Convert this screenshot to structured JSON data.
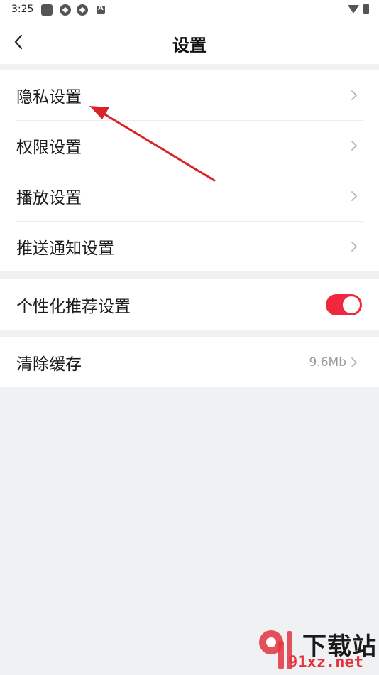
{
  "status_bar": {
    "time": "3:25"
  },
  "header": {
    "title": "设置",
    "back_icon": "chevron-left-icon"
  },
  "section_1": {
    "items": [
      {
        "label": "隐私设置"
      },
      {
        "label": "权限设置"
      },
      {
        "label": "播放设置"
      },
      {
        "label": "推送通知设置"
      }
    ]
  },
  "section_2": {
    "label": "个性化推荐设置",
    "toggle_on": true
  },
  "section_3": {
    "label": "清除缓存",
    "value": "9.6Mb"
  },
  "colors": {
    "accent": "#f0283e",
    "annotation_arrow": "#d9232b",
    "background": "#f0f1f3"
  },
  "watermark": {
    "top": "下载站",
    "bottom": "91xz.net"
  }
}
